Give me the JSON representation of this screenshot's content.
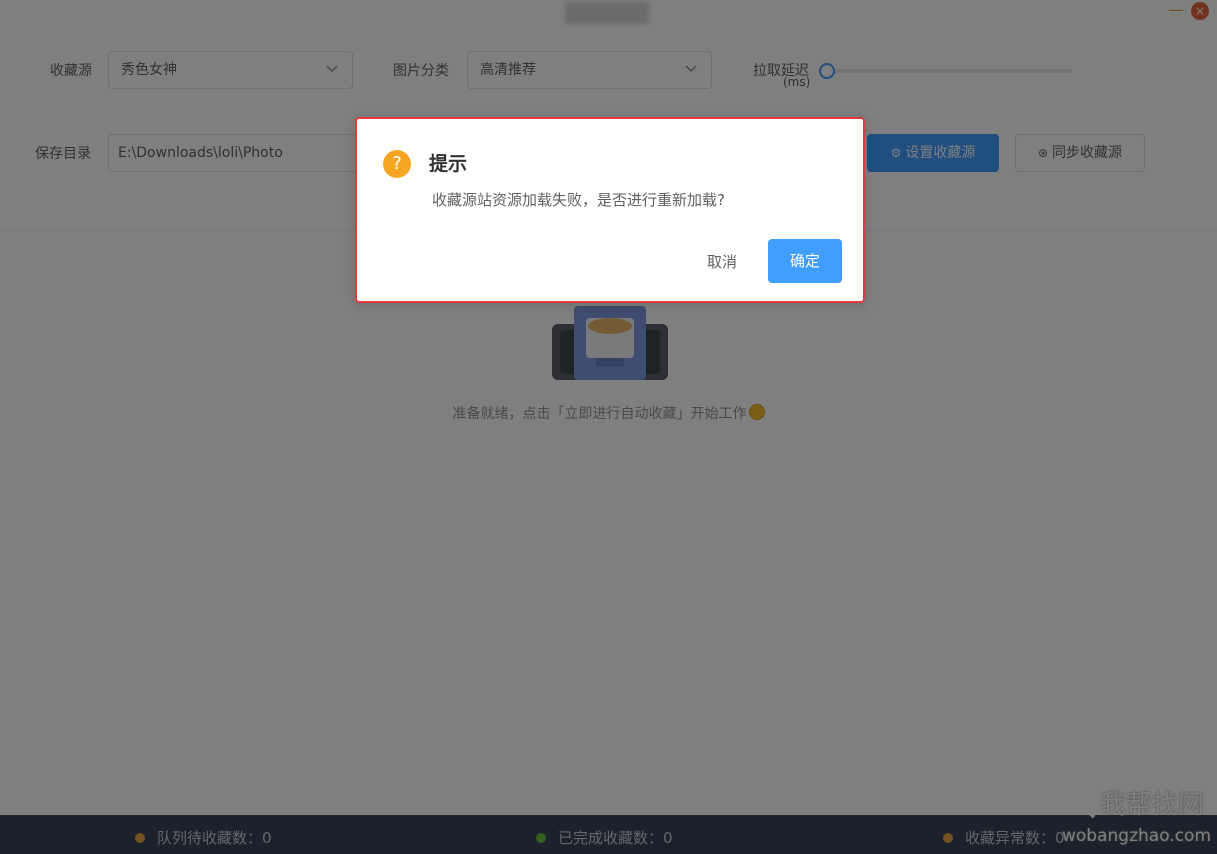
{
  "window": {
    "minimize_glyph": "—",
    "close_glyph": "×"
  },
  "form": {
    "source_label": "收藏源",
    "source_value": "秀色女神",
    "category_label": "图片分类",
    "category_value": "高清推荐",
    "delay_label": "拉取延迟",
    "delay_unit": "(ms)",
    "delay_value": 0,
    "save_dir_label": "保存目录",
    "save_dir_value": "E:\\Downloads\\loli\\Photo",
    "set_source_button": "设置收藏源",
    "sync_source_button": "同步收藏源"
  },
  "empty_state": {
    "text": "准备就绪，点击「立即进行自动收藏」开始工作"
  },
  "status": {
    "queue_label": "队列待收藏数：0",
    "done_label": "已完成收藏数：0",
    "error_label": "收藏异常数：0",
    "queue_color": "#e6a23c",
    "done_color": "#67c23a",
    "error_color": "#e6a23c"
  },
  "watermark": {
    "logo_text": "我帮找网",
    "url": "wobangzhao.com"
  },
  "dialog": {
    "icon_glyph": "?",
    "title": "提示",
    "message": "收藏源站资源加载失败，是否进行重新加载?",
    "cancel_label": "取消",
    "confirm_label": "确定"
  },
  "colors": {
    "primary": "#409eff",
    "warning": "#f5a623",
    "highlight_border": "#e23b3b",
    "statusbar": "#394456"
  }
}
